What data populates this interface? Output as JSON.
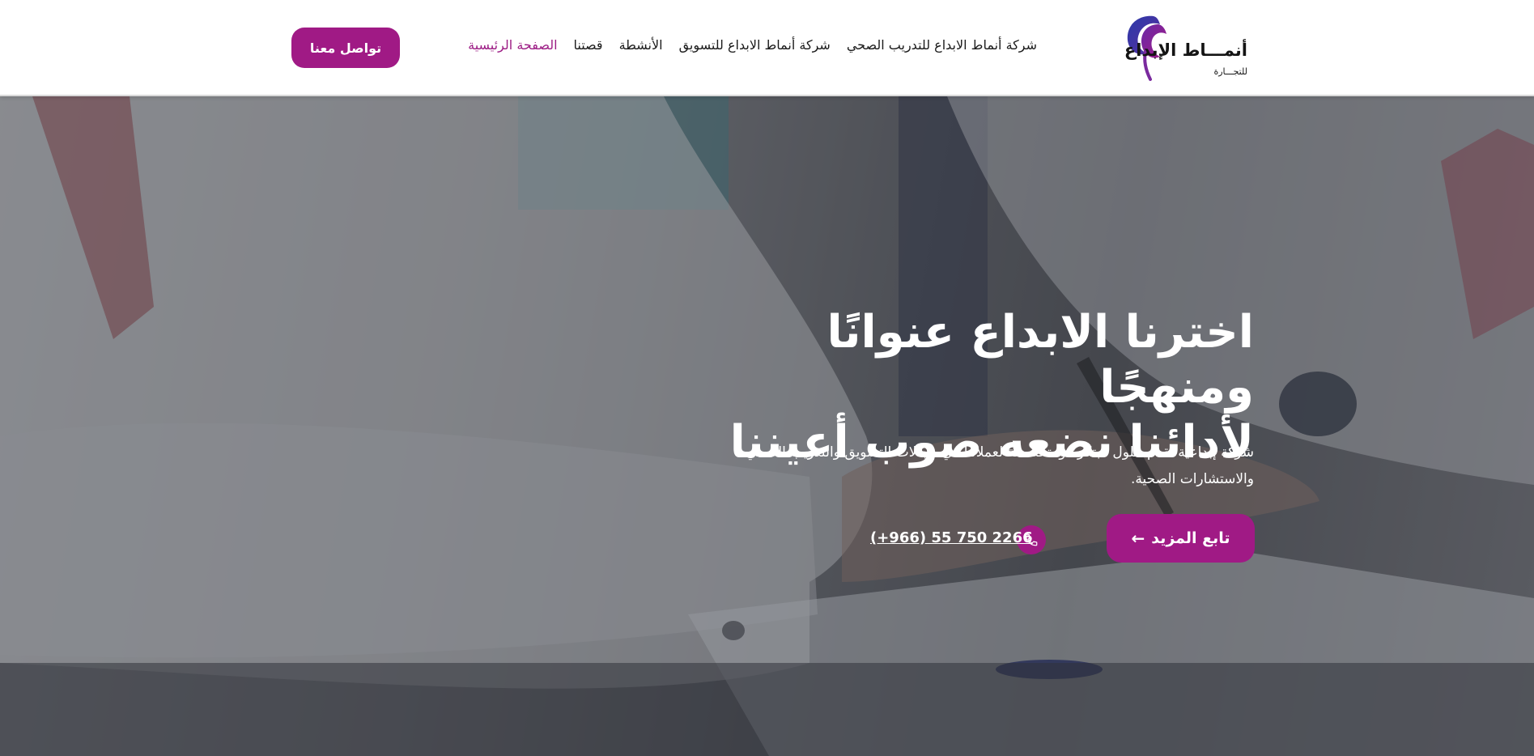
{
  "header": {
    "logo": {
      "title": "أنمـــاط الإبداع",
      "subtitle": "للتجـــارة"
    },
    "nav": [
      {
        "label": "الصفحة الرئيسية",
        "active": true
      },
      {
        "label": "قصتنا",
        "active": false
      },
      {
        "label": "الأنشطة",
        "active": false
      },
      {
        "label": "شركة أنماط الابداع للتسويق",
        "active": false
      },
      {
        "label": "شركة أنماط الابداع للتدريب الصحي",
        "active": false
      }
    ],
    "contact_button": "تواصل معنا"
  },
  "hero": {
    "title_line1": "اخترنا الابداع عنوانًا ومنهجًا",
    "title_line2": "لأدائنا نضعه صوب أعيننا",
    "description": "شركة إبداعية تقدم حلول مبتكرة ومتخصصة لعملائنا في مجالات التسويق والتدريب الصحي والاستشارات الصحية.",
    "cta_button": "تابع المزيد",
    "phone": "(+966) 55 750 2266",
    "icons": {
      "cta": "arrow-left-icon",
      "phone": "phone-icon"
    }
  },
  "colors": {
    "brand": "#a01a85",
    "nav_active": "#9c1c84",
    "text_dark": "#1a1a1a"
  }
}
